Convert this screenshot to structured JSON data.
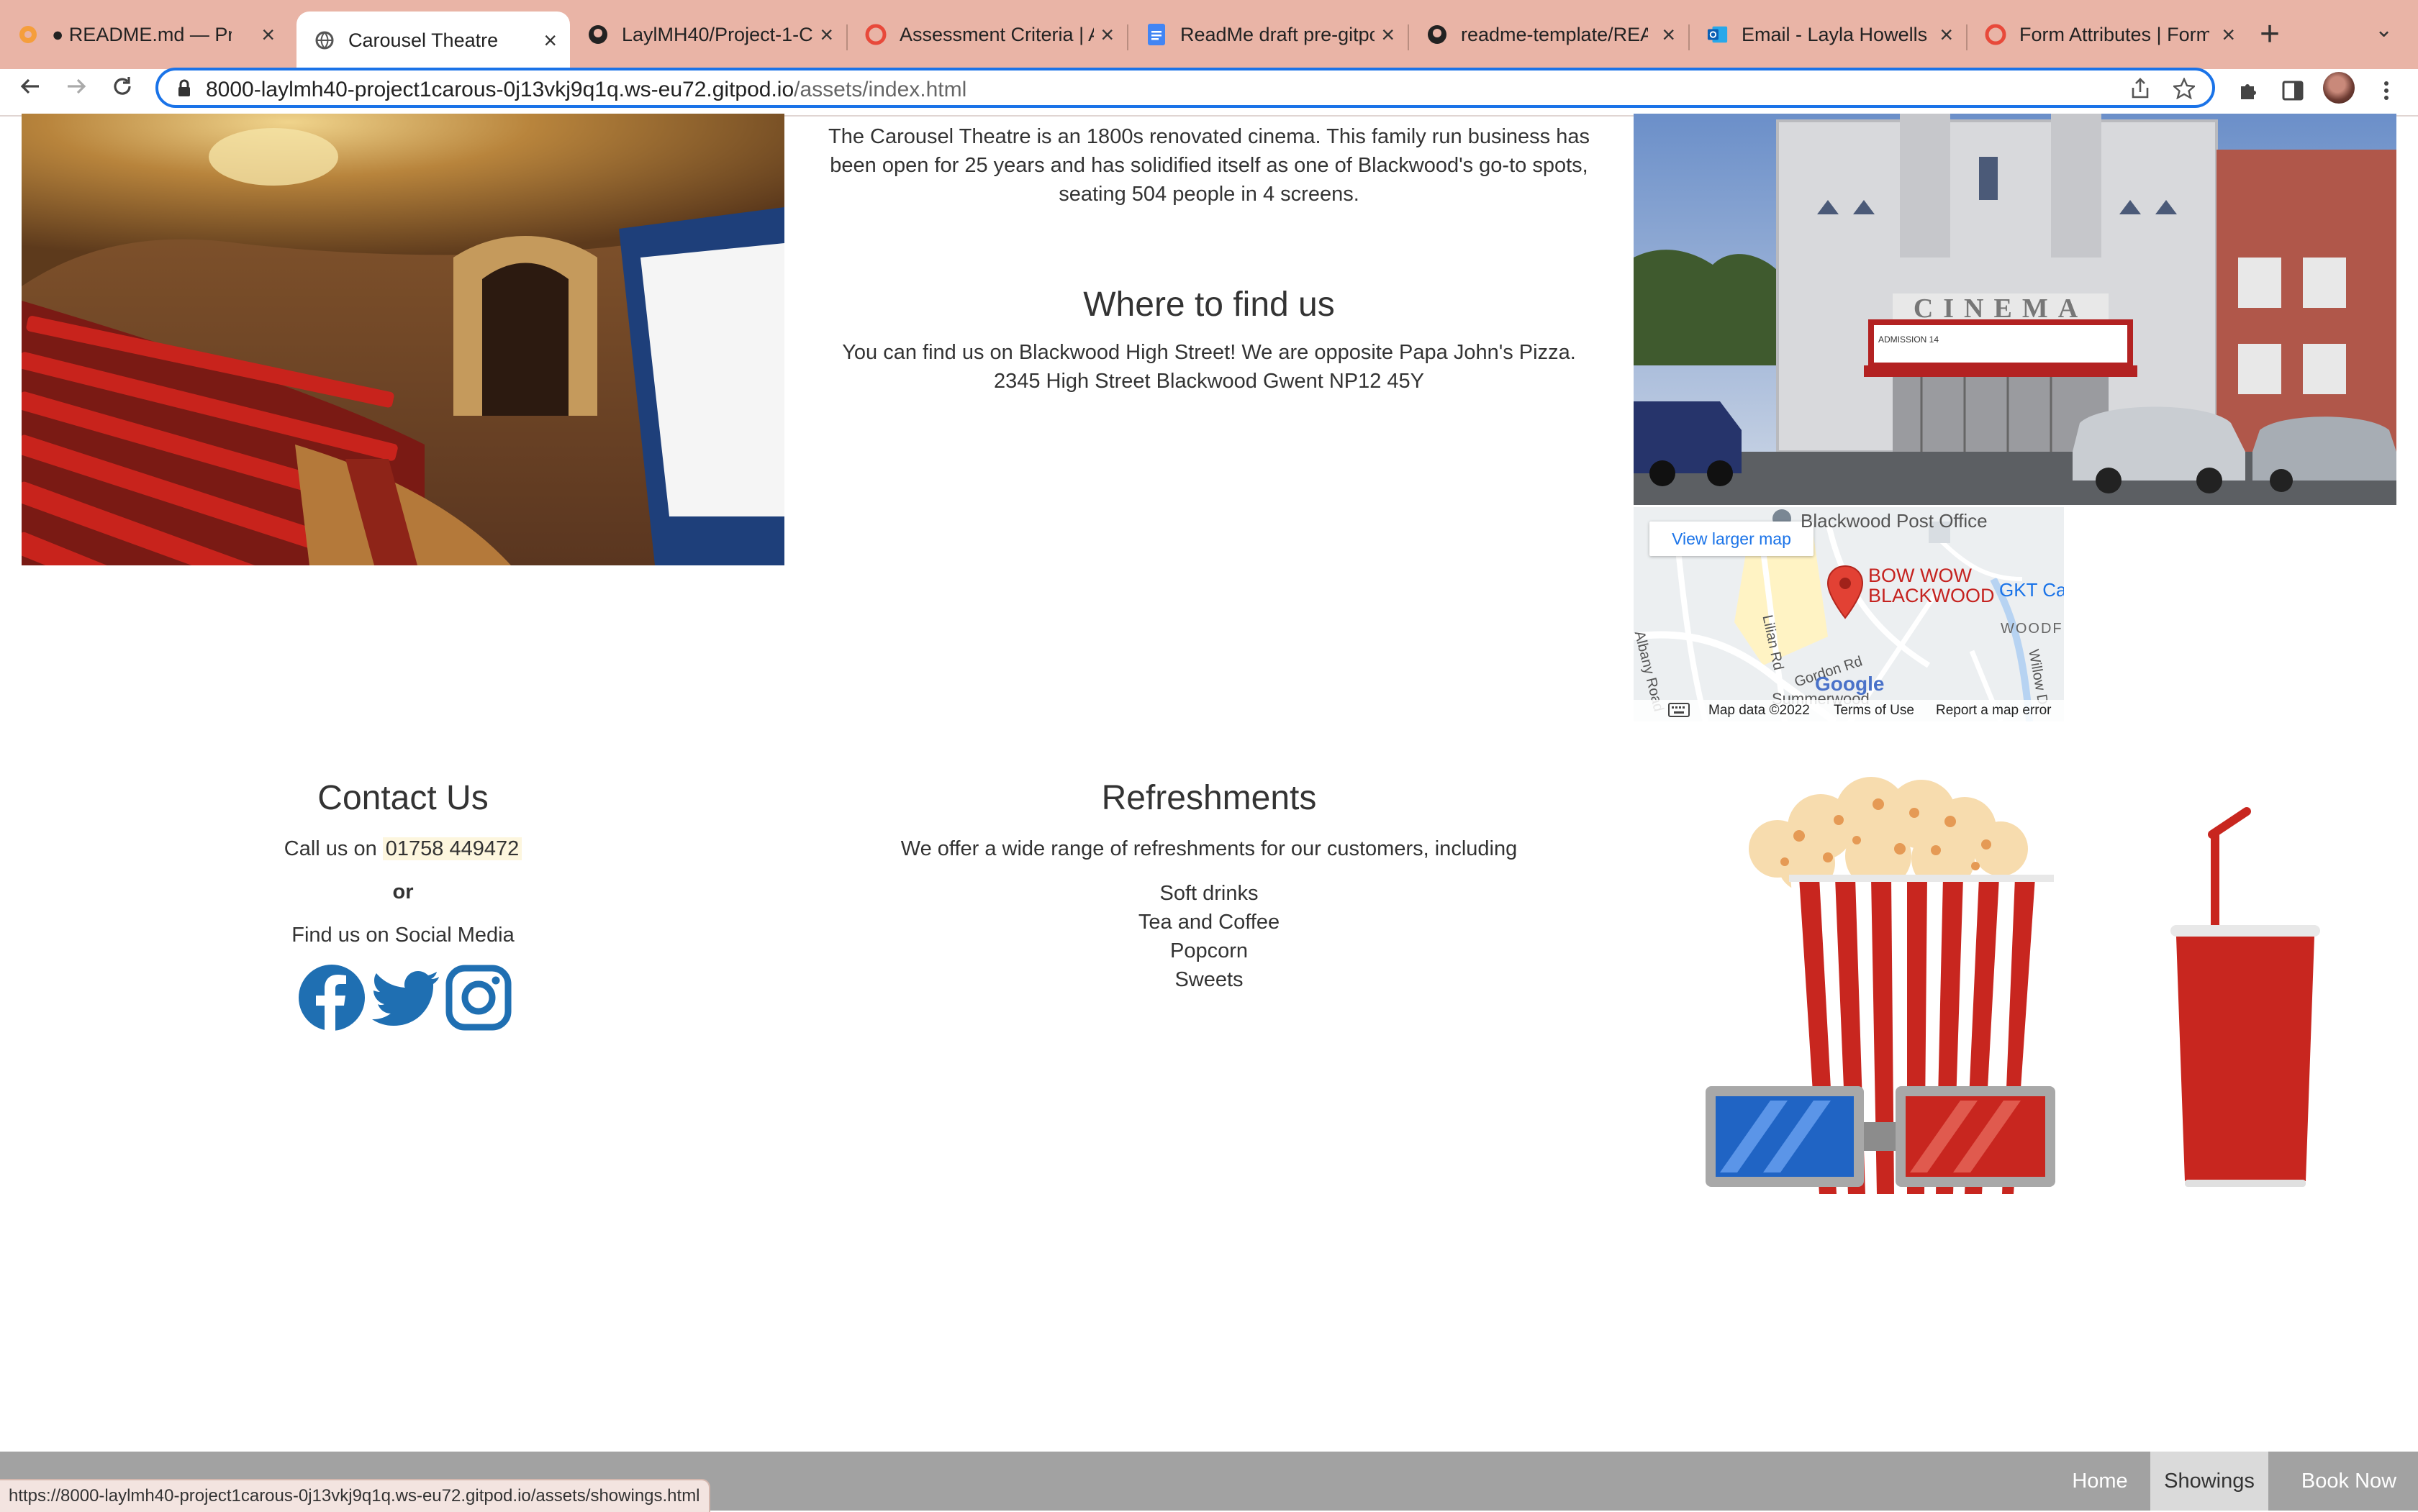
{
  "browser": {
    "tabs": [
      {
        "label": "● README.md — Proj",
        "icon": "gitpod-icon",
        "active": false
      },
      {
        "label": "Carousel Theatre",
        "icon": "globe-icon",
        "active": true
      },
      {
        "label": "LaylMH40/Project-1-C",
        "icon": "github-icon",
        "active": false
      },
      {
        "label": "Assessment Criteria | A",
        "icon": "codeinstitute-icon",
        "active": false
      },
      {
        "label": "ReadMe draft pre-gitpo",
        "icon": "google-docs-icon",
        "active": false
      },
      {
        "label": "readme-template/REA",
        "icon": "github-icon",
        "active": false
      },
      {
        "label": "Email - Layla Howells -",
        "icon": "outlook-icon",
        "active": false
      },
      {
        "label": "Form Attributes | Form",
        "icon": "codeinstitute-icon",
        "active": false
      }
    ],
    "url_host": "8000-laylmh40-project1carous-0j13vkj9q1q.ws-eu72.gitpod.io",
    "url_path": "/assets/index.html",
    "status_url": "https://8000-laylmh40-project1carous-0j13vkj9q1q.ws-eu72.gitpod.io/assets/showings.html"
  },
  "about": {
    "text": "The Carousel Theatre is an 1800s renovated cinema. This family run business has been open for 25 years and has solidified itself as one of Blackwood's go-to spots, seating 504 people in 4 screens."
  },
  "location": {
    "heading": "Where to find us",
    "line1": "You can find us on Blackwood High Street! We are opposite Papa John's Pizza.",
    "line2": "2345 High Street Blackwood Gwent NP12 45Y"
  },
  "map": {
    "view_larger": "View larger map",
    "labels": {
      "post_office": "Blackwood Post Office",
      "place_line1": "BOW WOW",
      "place_line2": "BLACKWOOD",
      "gkt": "GKT Ca",
      "woodfield": "WOODFI",
      "albany": "Albany Road",
      "lilian": "Lilian Rd",
      "gordon": "Gordon Rd",
      "willow": "Willow D",
      "summerwood": "Summerwood",
      "google": "Google"
    },
    "footer": {
      "data": "Map data ©2022",
      "terms": "Terms of Use",
      "report": "Report a map error"
    }
  },
  "photo": {
    "marquee": "CINEMA",
    "admission": "ADMISSION 14"
  },
  "contact": {
    "heading": "Contact Us",
    "call_prefix": "Call us on ",
    "phone": "01758 449472",
    "or": "or",
    "social_text": "Find us on Social Media",
    "social": [
      "facebook-icon",
      "twitter-icon",
      "instagram-icon"
    ],
    "social_color": "#1f6fb2"
  },
  "refreshments": {
    "heading": "Refreshments",
    "intro": "We offer a wide range of refreshments for our customers, including",
    "items": [
      "Soft drinks",
      "Tea and Coffee",
      "Popcorn",
      "Sweets"
    ]
  },
  "nav": {
    "home": "Home",
    "showings": "Showings",
    "book": "Book Now"
  },
  "colors": {
    "tabbar": "#e9b4a6",
    "accent_blue": "#1a73e8",
    "nav_bg": "#a2a2a2"
  }
}
